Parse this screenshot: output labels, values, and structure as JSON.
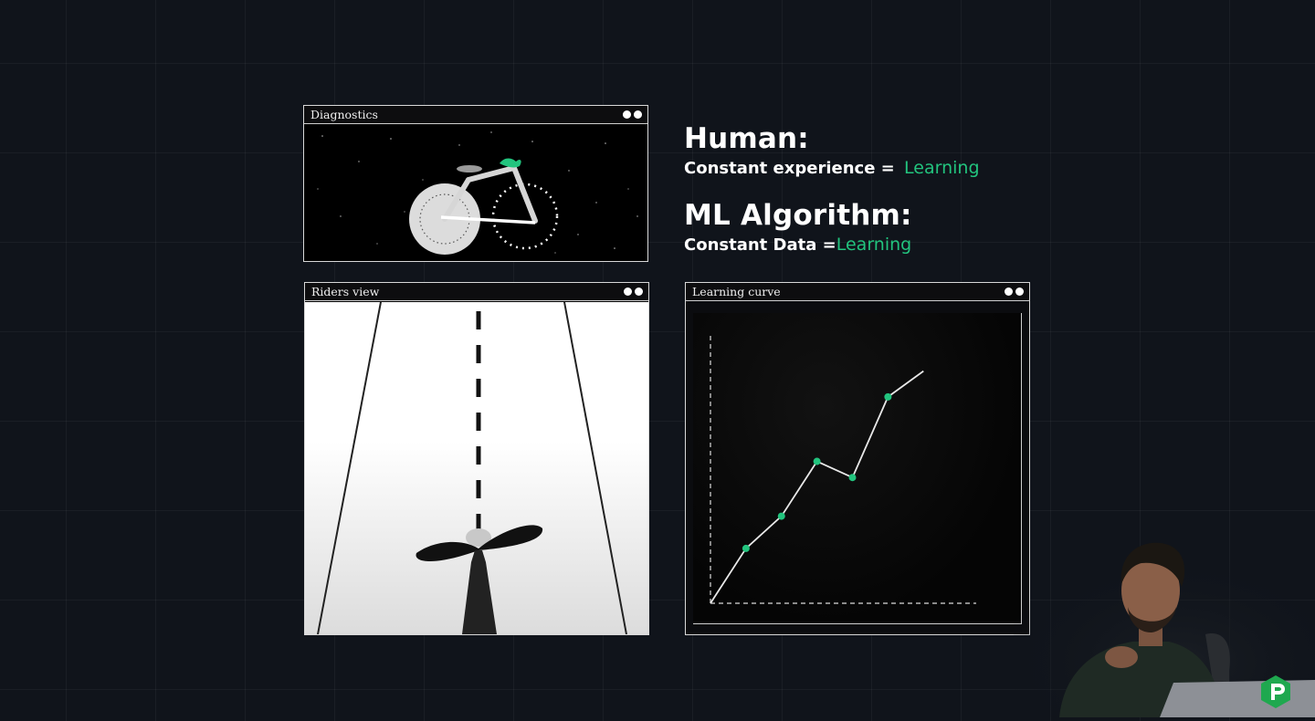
{
  "panels": {
    "diagnostics": {
      "title": "Diagnostics"
    },
    "riders": {
      "title": "Riders view"
    },
    "curve": {
      "title": "Learning curve"
    }
  },
  "human": {
    "heading": "Human:",
    "line_label": "Constant experience =",
    "line_value": "Learning"
  },
  "ml": {
    "heading": "ML Algorithm:",
    "line_label": "Constant Data =",
    "line_value": "Learning"
  },
  "colors": {
    "accent": "#22c47e",
    "background": "#10141b"
  },
  "chart_data": {
    "type": "line",
    "title": "",
    "xlabel": "",
    "ylabel": "",
    "x": [
      0,
      1,
      2,
      3,
      4,
      5,
      6
    ],
    "values": [
      0,
      1.7,
      2.7,
      4.4,
      3.9,
      6.4,
      7.2
    ],
    "markers": [
      false,
      true,
      true,
      true,
      true,
      true,
      false
    ],
    "ylim": [
      0,
      9
    ],
    "xlim": [
      0,
      8
    ],
    "grid": false,
    "axes_style": "dashed"
  }
}
